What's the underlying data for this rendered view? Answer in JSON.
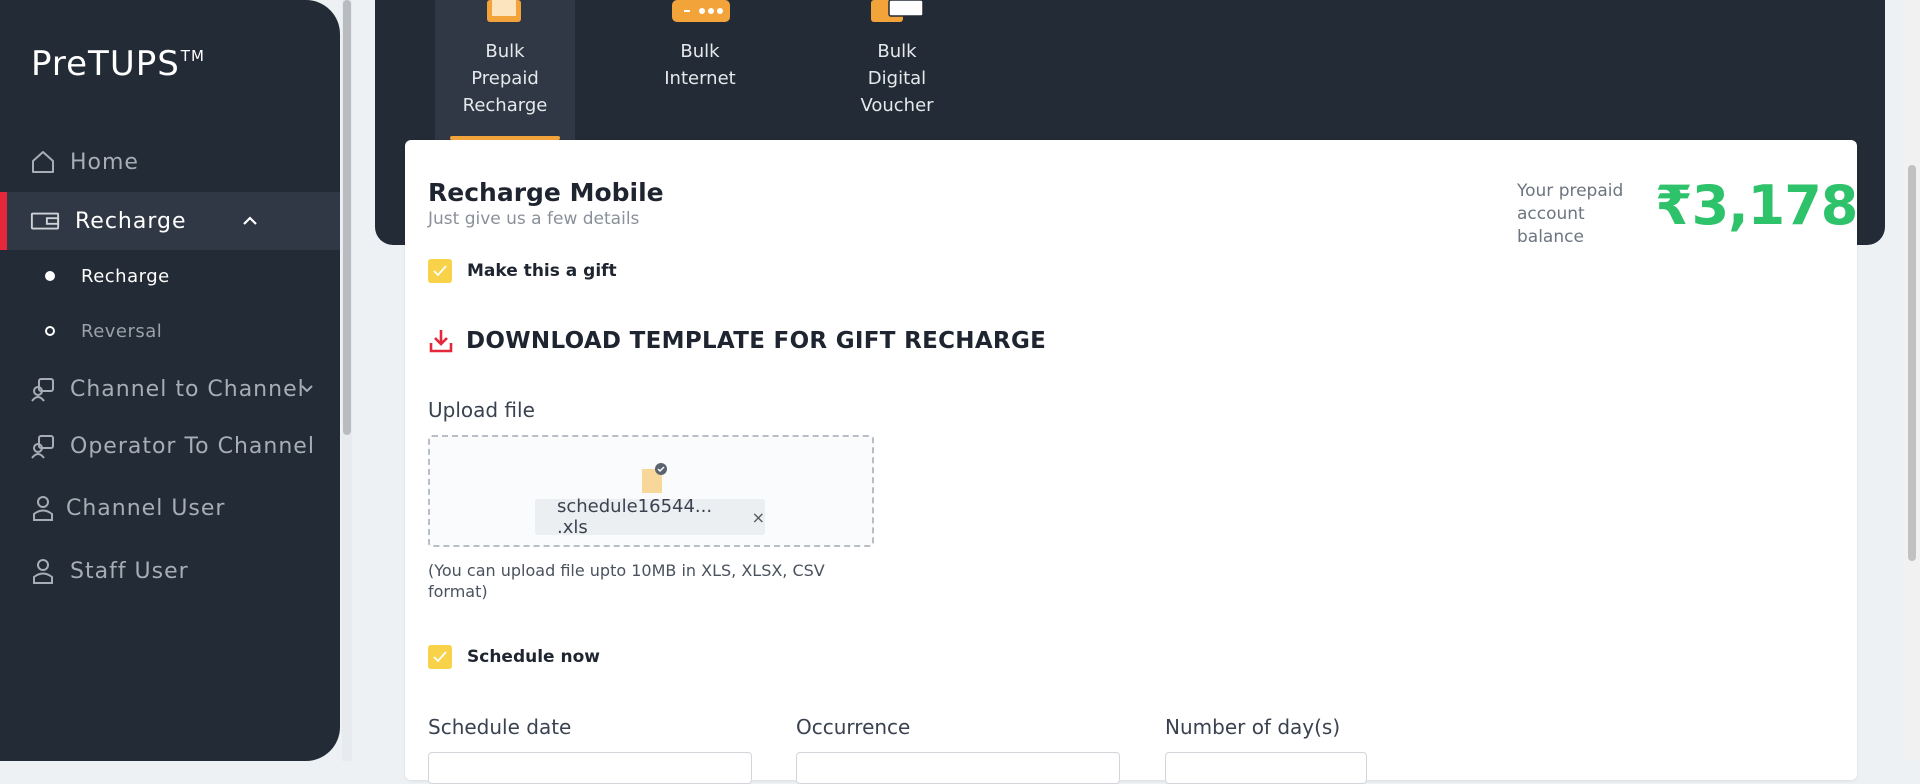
{
  "app": {
    "logo_text": "PreTUPS",
    "logo_mark": "TM"
  },
  "sidebar": {
    "items": [
      {
        "label": "Home",
        "icon": "home-icon"
      },
      {
        "label": "Recharge",
        "icon": "wallet-icon"
      },
      {
        "label": "Channel to Channel",
        "icon": "channel-transfer-icon"
      },
      {
        "label": "Operator To Channel",
        "icon": "operator-channel-icon"
      },
      {
        "label": "Channel User",
        "icon": "user-icon"
      },
      {
        "label": "Staff User",
        "icon": "staff-user-icon"
      }
    ],
    "sub_items": [
      {
        "label": "Recharge"
      },
      {
        "label": "Reversal"
      }
    ]
  },
  "tabs": [
    {
      "line1": "Bulk",
      "line2": "Prepaid",
      "line3": "Recharge"
    },
    {
      "line1": "Bulk",
      "line2": "Internet",
      "line3": ""
    },
    {
      "line1": "Bulk",
      "line2": "Digital",
      "line3": "Voucher"
    }
  ],
  "form": {
    "title": "Recharge Mobile",
    "subtitle": "Just give us a few details",
    "balance_label_1": "Your prepaid",
    "balance_label_2": "account balance",
    "balance_amount": "₹3,178",
    "gift_label": "Make this a gift",
    "download_label": "DOWNLOAD TEMPLATE FOR GIFT RECHARGE",
    "upload_label": "Upload file",
    "file_name": "schedule16544... .xls",
    "file_remove": "×",
    "upload_hint": "(You can upload file upto 10MB in XLS, XLSX, CSV format)",
    "schedule_label": "Schedule now",
    "schedule_date_label": "Schedule date",
    "occurrence_label": "Occurrence",
    "days_label": "Number of day(s)"
  },
  "colors": {
    "accent": "#f2a43a",
    "balance": "#2ec26a",
    "active_bar": "#e4273a",
    "checkbox": "#f8d34a"
  }
}
